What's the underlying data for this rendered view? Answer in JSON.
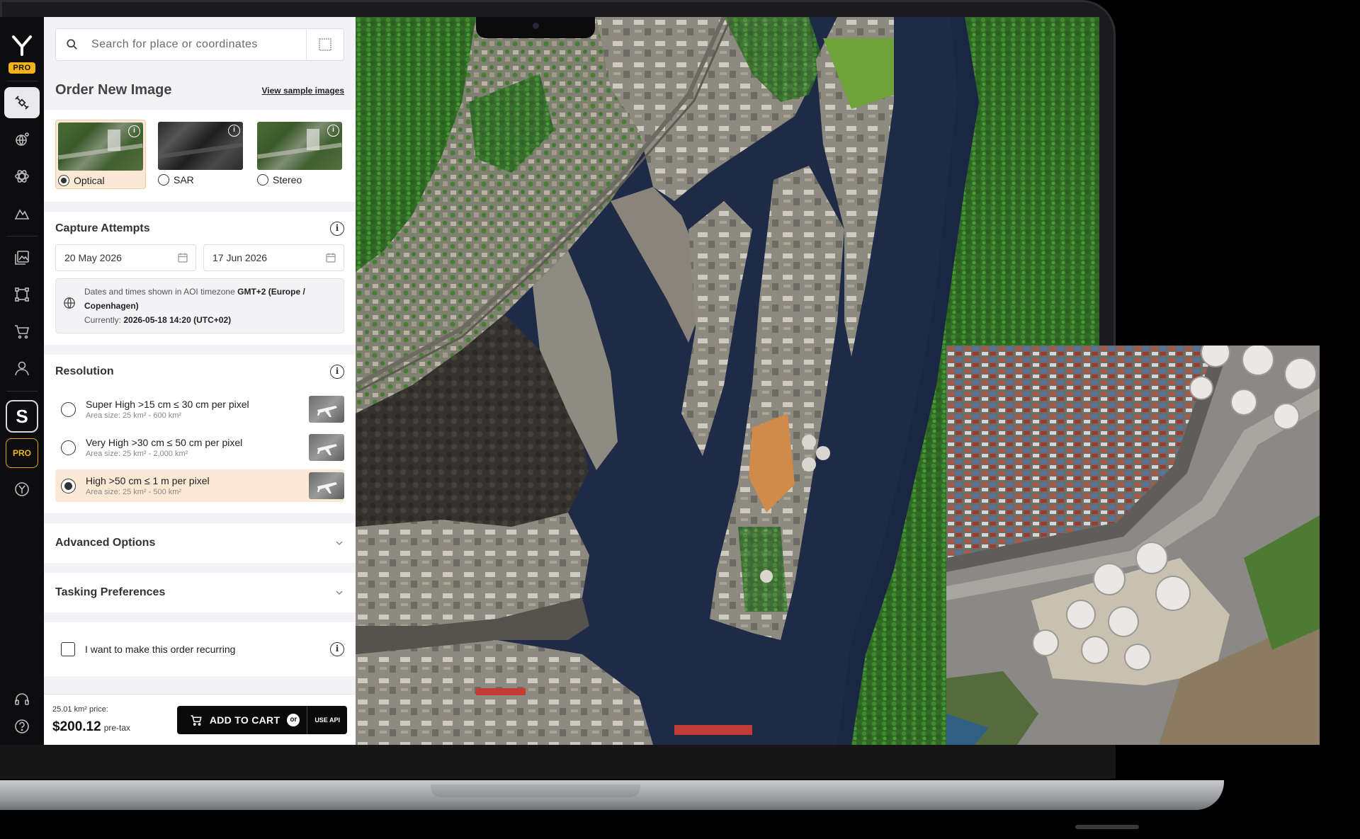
{
  "search": {
    "placeholder": "Search for place or coordinates"
  },
  "rail": {
    "pro_badge": "PRO",
    "s_label": "S",
    "pro_label": "PRO"
  },
  "order": {
    "title": "Order New Image",
    "sample_link": "View sample images",
    "image_types": [
      {
        "label": "Optical",
        "selected": true
      },
      {
        "label": "SAR",
        "selected": false
      },
      {
        "label": "Stereo",
        "selected": false
      }
    ]
  },
  "capture": {
    "title": "Capture Attempts",
    "start_date": "20 May 2026",
    "end_date": "17 Jun 2026",
    "tz_prefix": "Dates and times shown in AOI timezone",
    "tz_value": "GMT+2 (Europe / Copenhagen)",
    "current_prefix": "Currently:",
    "current_value": "2026-05-18 14:20 (UTC+02)"
  },
  "resolution": {
    "title": "Resolution",
    "options": [
      {
        "title": "Super High >15 cm ≤ 30 cm per pixel",
        "area": "Area size: 25 km² - 600 km²",
        "selected": false
      },
      {
        "title": "Very High >30 cm ≤ 50 cm per pixel",
        "area": "Area size: 25 km² - 2,000 km²",
        "selected": false
      },
      {
        "title": "High >50 cm ≤ 1 m per pixel",
        "area": "Area size: 25 km² - 500 km²",
        "selected": true
      }
    ]
  },
  "advanced": {
    "title": "Advanced Options"
  },
  "tasking": {
    "title": "Tasking Preferences"
  },
  "recurring": {
    "label": "I want to make this order recurring",
    "checked": false
  },
  "footer": {
    "area_price_label": "25.01 km² price:",
    "price": "$200.12",
    "pretax": "pre-tax",
    "add_to_cart": "ADD TO CART",
    "or": "or",
    "use_api": "USE API"
  },
  "colors": {
    "accent": "#f2b318",
    "selection_bg": "#fbe9d6",
    "water": "#1c2a45",
    "vegetation": "#2f6b25"
  }
}
